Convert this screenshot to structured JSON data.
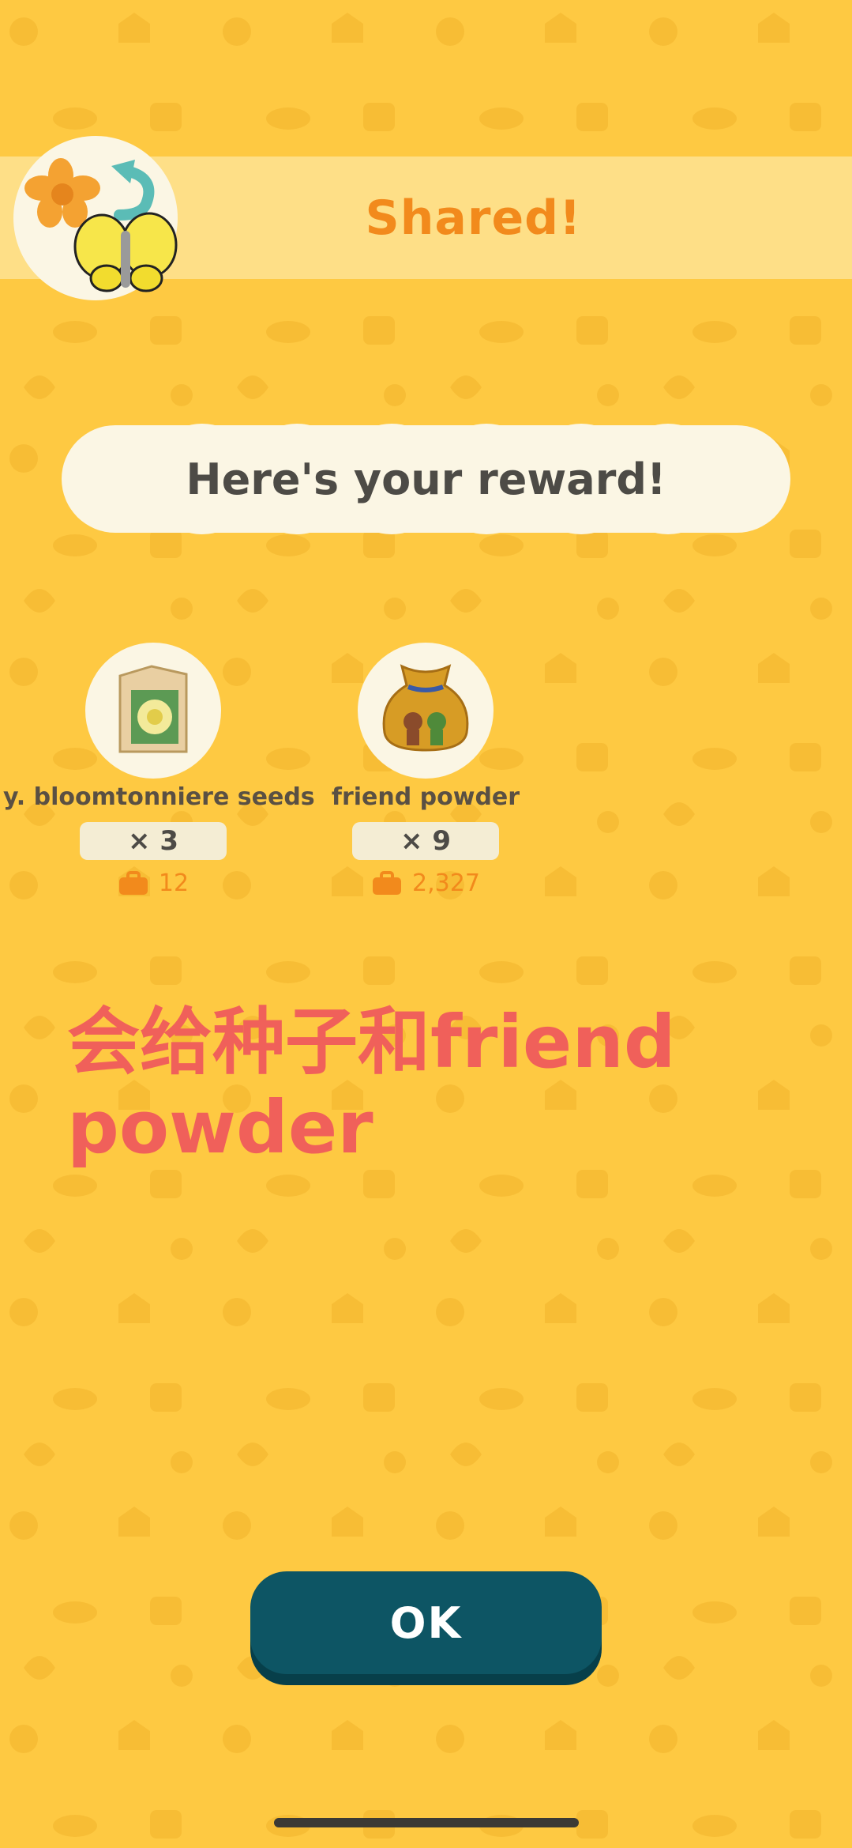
{
  "header": {
    "title": "Shared!",
    "badge_icon": "flower-butterfly-share-icon"
  },
  "banner_message": "Here's your reward!",
  "rewards": [
    {
      "name": "y. bloomtonniere seeds",
      "quantity": "× 3",
      "owned": "12",
      "icon": "seed-packet-icon"
    },
    {
      "name": "friend powder",
      "quantity": "× 9",
      "owned": "2,327",
      "icon": "friend-powder-bag-icon"
    }
  ],
  "annotation": {
    "line1": "会给种子和friend",
    "line2": "powder"
  },
  "ok_button": {
    "label": "OK"
  },
  "colors": {
    "background": "#fec942",
    "title_orange": "#f28a1c",
    "button_teal": "#0d5564",
    "annotation_red": "#f0605a"
  }
}
